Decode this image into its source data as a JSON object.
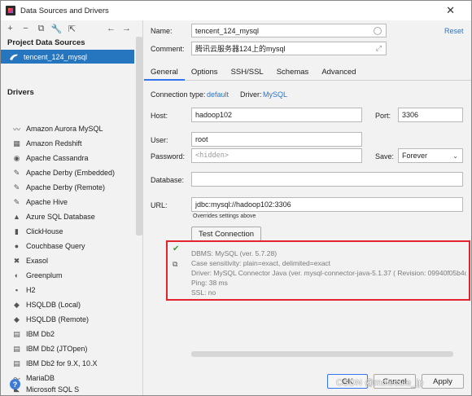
{
  "window": {
    "title": "Data Sources and Drivers"
  },
  "sidebar": {
    "project_header": "Project Data Sources",
    "project_item": "tencent_124_mysql",
    "drivers_header": "Drivers",
    "drivers": [
      {
        "label": "Amazon Aurora MySQL",
        "icon": "aurora-icon"
      },
      {
        "label": "Amazon Redshift",
        "icon": "redshift-icon"
      },
      {
        "label": "Apache Cassandra",
        "icon": "cassandra-icon"
      },
      {
        "label": "Apache Derby (Embedded)",
        "icon": "derby-icon"
      },
      {
        "label": "Apache Derby (Remote)",
        "icon": "derby-icon"
      },
      {
        "label": "Apache Hive",
        "icon": "hive-icon"
      },
      {
        "label": "Azure SQL Database",
        "icon": "azure-icon"
      },
      {
        "label": "ClickHouse",
        "icon": "clickhouse-icon"
      },
      {
        "label": "Couchbase Query",
        "icon": "couchbase-icon"
      },
      {
        "label": "Exasol",
        "icon": "exasol-icon"
      },
      {
        "label": "Greenplum",
        "icon": "greenplum-icon"
      },
      {
        "label": "H2",
        "icon": "h2-icon"
      },
      {
        "label": "HSQLDB (Local)",
        "icon": "hsqldb-icon"
      },
      {
        "label": "HSQLDB (Remote)",
        "icon": "hsqldb-icon"
      },
      {
        "label": "IBM Db2",
        "icon": "db2-icon"
      },
      {
        "label": "IBM Db2 (JTOpen)",
        "icon": "db2-icon"
      },
      {
        "label": "IBM Db2 for 9.X, 10.X",
        "icon": "db2-icon"
      },
      {
        "label": "MariaDB",
        "icon": "mariadb-icon"
      },
      {
        "label": "Microsoft SQL S",
        "icon": "mssql-icon"
      }
    ]
  },
  "form": {
    "name_label": "Name:",
    "name_value": "tencent_124_mysql",
    "comment_label": "Comment:",
    "comment_value": "腾讯云服务器124上的mysql",
    "reset": "Reset",
    "tabs": [
      "General",
      "Options",
      "SSH/SSL",
      "Schemas",
      "Advanced"
    ],
    "connection_type_label": "Connection type:",
    "connection_type_value": "default",
    "driver_label": "Driver:",
    "driver_value": "MySQL",
    "host_label": "Host:",
    "host_value": "hadoop102",
    "port_label": "Port:",
    "port_value": "3306",
    "user_label": "User:",
    "user_value": "root",
    "password_label": "Password:",
    "password_placeholder": "<hidden>",
    "save_label": "Save:",
    "save_value": "Forever",
    "database_label": "Database:",
    "database_value": "",
    "url_label": "URL:",
    "url_value": "jdbc:mysql://hadoop102:3306",
    "url_hint": "Overrides settings above",
    "test_button": "Test Connection"
  },
  "test_result": {
    "lines": [
      "DBMS: MySQL (ver. 5.7.28)",
      "Case sensitivity: plain=exact, delimited=exact",
      "Driver: MySQL Connector Java (ver. mysql-connector-java-5.1.37 ( Revision: 09940f05b4c",
      "Ping: 38 ms",
      "SSL: no"
    ]
  },
  "footer": {
    "ok": "OK",
    "cancel": "Cancel",
    "apply": "Apply",
    "watermark": "CSDN @molecule_jp"
  },
  "colors": {
    "accent": "#2675bf",
    "link": "#2b73c8",
    "highlight_border": "#e3242b",
    "success": "#3a9b3a"
  }
}
